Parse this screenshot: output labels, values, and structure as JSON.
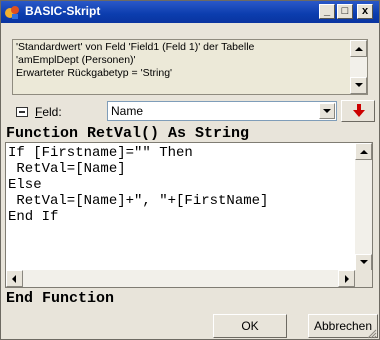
{
  "window": {
    "title": "BASIC-Skript",
    "icons": {
      "app": "app-icon",
      "minimize": "minimize-icon",
      "maximize": "maximize-icon",
      "close": "close-icon"
    },
    "controls": {
      "minimize": "_",
      "maximize": "□",
      "close": "x"
    }
  },
  "info": {
    "text": "'Standardwert' von Feld 'Field1 (Feld 1)' der Tabelle\n'amEmplDept (Personen)'\nErwarteter Rückgabetyp = 'String'"
  },
  "field": {
    "label_prefix": "F",
    "label_rest": "eld:",
    "selected": "Name",
    "icon": "field-icon",
    "insert_icon": "insert-arrow-icon"
  },
  "code": {
    "header": "Function RetVal() As String",
    "body": "If [Firstname]=\"\" Then\n RetVal=[Name]\nElse\n RetVal=[Name]+\", \"+[FirstName]\nEnd If",
    "footer": "End Function"
  },
  "buttons": {
    "ok": "OK",
    "cancel": "Abbrechen"
  },
  "colors": {
    "titlebar": "#0b3dae",
    "dialog": "#e8e4da",
    "insert_arrow": "#cc0000"
  }
}
